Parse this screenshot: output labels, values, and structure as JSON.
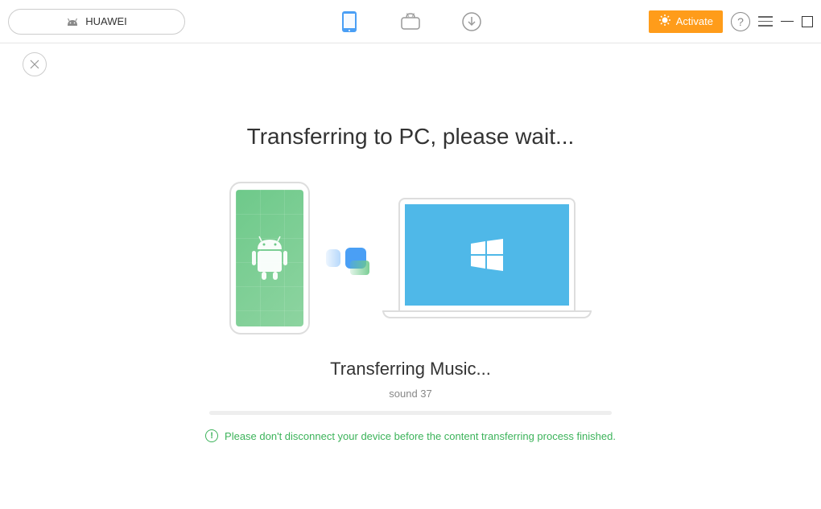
{
  "toolbar": {
    "device_name": "HUAWEI",
    "activate_label": "Activate"
  },
  "main": {
    "title": "Transferring to PC, please wait...",
    "subtitle": "Transferring Music...",
    "current_file": "sound 37",
    "warning_text": "Please don't disconnect your device before the content transferring process finished."
  },
  "colors": {
    "accent_orange": "#ff9c1a",
    "accent_green": "#3cb35a",
    "accent_blue": "#4a9ff5",
    "laptop_blue": "#4fb8e8",
    "phone_green": "#6ec98a"
  }
}
